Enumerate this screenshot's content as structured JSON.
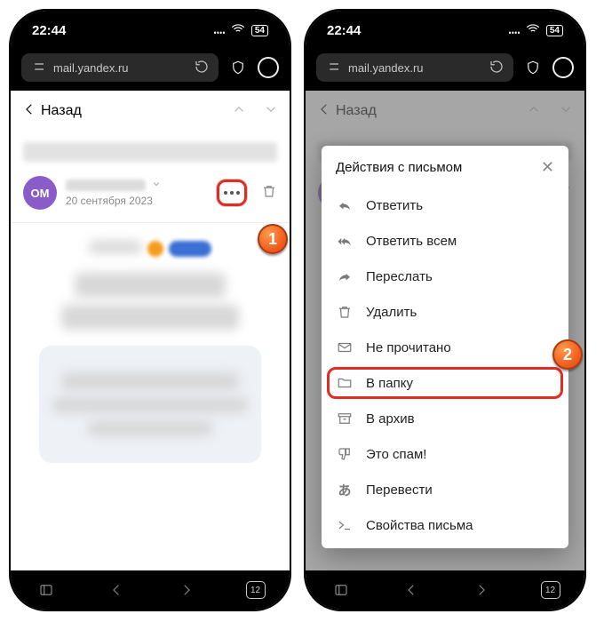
{
  "status": {
    "time": "22:44",
    "battery": "54"
  },
  "url": "mail.yandex.ru",
  "back_label": "Назад",
  "avatar_initials": "ОМ",
  "message_date": "20 сентября 2023",
  "tabs_count": "12",
  "menu": {
    "title": "Действия с письмом",
    "items": [
      {
        "key": "reply",
        "label": "Ответить"
      },
      {
        "key": "reply_all",
        "label": "Ответить всем"
      },
      {
        "key": "forward",
        "label": "Переслать"
      },
      {
        "key": "delete",
        "label": "Удалить"
      },
      {
        "key": "unread",
        "label": "Не прочитано"
      },
      {
        "key": "to_folder",
        "label": "В папку"
      },
      {
        "key": "archive",
        "label": "В архив"
      },
      {
        "key": "spam",
        "label": "Это спам!"
      },
      {
        "key": "translate",
        "label": "Перевести"
      },
      {
        "key": "props",
        "label": "Свойства письма"
      }
    ]
  },
  "callouts": {
    "one": "1",
    "two": "2"
  }
}
